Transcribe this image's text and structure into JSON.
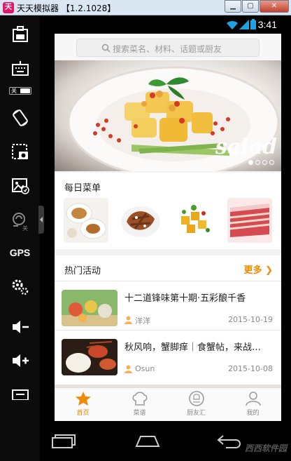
{
  "window": {
    "title": "天天模拟器 【1.2.1028】",
    "app_icon_glyph": "天",
    "buttons": [
      "minimize",
      "maximize",
      "close"
    ]
  },
  "sidebar": {
    "items": [
      {
        "name": "apk-install-icon"
      },
      {
        "name": "keyboard-icon",
        "toggle_label": "关"
      },
      {
        "name": "rotate-icon"
      },
      {
        "name": "screenshot-icon"
      },
      {
        "name": "gallery-icon"
      },
      {
        "name": "shake-icon",
        "badge": "关"
      },
      {
        "name": "gps",
        "label": "GPS"
      },
      {
        "name": "settings-icon"
      },
      {
        "name": "volume-down-icon"
      },
      {
        "name": "volume-up-icon"
      },
      {
        "name": "menu-icon"
      }
    ]
  },
  "status": {
    "time": "3:41"
  },
  "search": {
    "placeholder": "搜索菜名、材料、话题或厨友"
  },
  "banner": {
    "overlay_text": "salad",
    "dots": 4,
    "active_dot": 0
  },
  "daily": {
    "title": "每日菜单",
    "thumbs": [
      "dish-1",
      "dish-2",
      "dish-3",
      "dish-4"
    ]
  },
  "events": {
    "title": "热门活动",
    "more_label": "更多",
    "items": [
      {
        "title": "十二道锋味第十期·五彩酿千香",
        "author": "洋洋",
        "date": "2015-10-19"
      },
      {
        "title": "秋风响，蟹脚痒｜食蟹帖，来战…",
        "author": "Osun",
        "date": "2015-10-08"
      }
    ]
  },
  "tabs": [
    {
      "label": "首页",
      "active": true
    },
    {
      "label": "菜谱",
      "active": false
    },
    {
      "label": "厨友汇",
      "active": false
    },
    {
      "label": "我的",
      "active": false
    }
  ],
  "watermark": "西西软件园",
  "colors": {
    "accent": "#f08a00",
    "sidebar_bg": "#0b0b0b",
    "titlebar_bg": "#dbe6f3"
  }
}
